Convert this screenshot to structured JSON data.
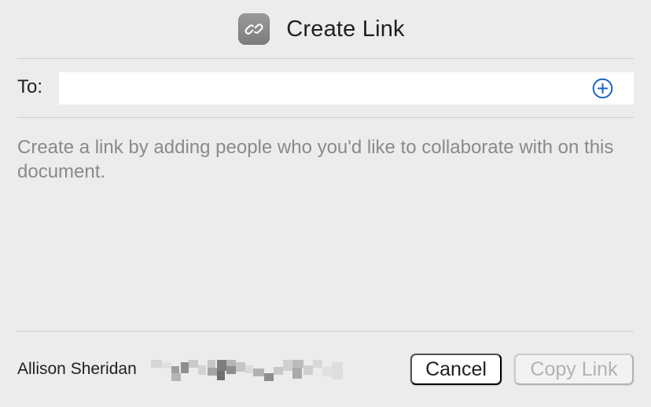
{
  "dialog": {
    "title": "Create Link",
    "title_icon": "link-icon"
  },
  "recipients": {
    "label": "To:",
    "value": "",
    "placeholder": "",
    "add_icon": "plus-circle-icon",
    "accent_color": "#1a64c8"
  },
  "description": "Create a link by adding people who you'd like to collaborate with on this document.",
  "footer": {
    "user_name": "Allison Sheridan",
    "cancel_label": "Cancel",
    "copy_link_label": "Copy Link",
    "copy_link_enabled": false
  }
}
